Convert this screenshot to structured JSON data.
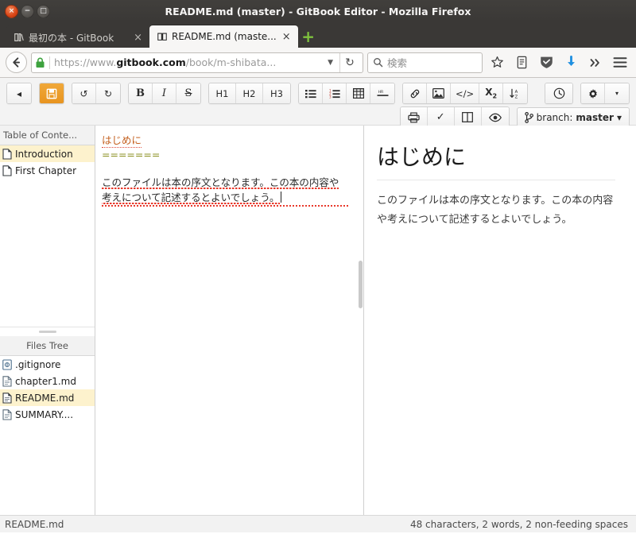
{
  "window": {
    "title": "README.md (master) - GitBook Editor - Mozilla Firefox",
    "close_label": "×",
    "minimize_label": "−",
    "maximize_label": "□"
  },
  "browser": {
    "tabs": [
      {
        "label": "最初の本 - GitBook",
        "close": "×",
        "icon": "gitbook-icon",
        "active": false
      },
      {
        "label": "README.md (maste...",
        "close": "×",
        "icon": "gitbook-icon",
        "active": true
      }
    ],
    "new_tab_label": "+",
    "back_label": "←",
    "url_prefix": "https://www.",
    "url_domain": "gitbook.com",
    "url_path": "/book/m-shibata...",
    "url_dropdown": "▼",
    "reload_label": "↻",
    "search_placeholder": "検索",
    "nav_icons": [
      "bookmark-star-icon",
      "reader-list-icon",
      "shield-icon",
      "downloads-icon",
      "overflow-chevrons-icon",
      "hamburger-menu-icon"
    ]
  },
  "editor_toolbar": {
    "row1": [
      {
        "group": [
          {
            "name": "back-button",
            "glyph": "◂"
          }
        ]
      },
      {
        "group": [
          {
            "name": "save-button",
            "glyph": "save-icon",
            "active": true
          }
        ]
      },
      {
        "group": [
          {
            "name": "undo-button",
            "glyph": "↺"
          },
          {
            "name": "redo-button",
            "glyph": "↻"
          }
        ]
      },
      {
        "group": [
          {
            "name": "bold-button",
            "glyph": "B"
          },
          {
            "name": "italic-button",
            "glyph": "I"
          },
          {
            "name": "strikethrough-button",
            "glyph": "S"
          }
        ]
      },
      {
        "group": [
          {
            "name": "heading1-button",
            "glyph": "H1"
          },
          {
            "name": "heading2-button",
            "glyph": "H2"
          },
          {
            "name": "heading3-button",
            "glyph": "H3"
          }
        ]
      },
      {
        "group": [
          {
            "name": "bullet-list-button",
            "glyph": "list-ul-icon"
          },
          {
            "name": "numbered-list-button",
            "glyph": "list-ol-icon"
          },
          {
            "name": "table-button",
            "glyph": "table-icon"
          },
          {
            "name": "horizontal-rule-button",
            "glyph": "HR"
          }
        ]
      },
      {
        "group": [
          {
            "name": "link-button",
            "glyph": "link-icon"
          },
          {
            "name": "image-button",
            "glyph": "image-icon"
          },
          {
            "name": "code-button",
            "glyph": "</>"
          },
          {
            "name": "subscript-button",
            "glyph": "X2"
          },
          {
            "name": "sort-button",
            "glyph": "sort-az-icon"
          }
        ]
      },
      {
        "group": [
          {
            "name": "history-button",
            "glyph": "clock-icon"
          }
        ]
      },
      {
        "group": [
          {
            "name": "settings-button",
            "glyph": "gear-icon"
          },
          {
            "name": "settings-dropdown-button",
            "glyph": "▾"
          }
        ]
      }
    ],
    "row2": [
      {
        "group": [
          {
            "name": "print-button",
            "glyph": "printer-icon"
          },
          {
            "name": "spellcheck-button",
            "glyph": "✓"
          },
          {
            "name": "split-view-button",
            "glyph": "columns-icon"
          },
          {
            "name": "preview-button",
            "glyph": "eye-icon"
          }
        ]
      }
    ],
    "branch": {
      "icon": "branch-icon",
      "prefix": "branch:",
      "name": "master",
      "caret": "▾"
    }
  },
  "sidebar": {
    "toc": {
      "header": "Table of Conte...",
      "items": [
        {
          "label": "Introduction",
          "icon": "file-icon",
          "selected": true
        },
        {
          "label": "First Chapter",
          "icon": "file-icon",
          "selected": false
        }
      ]
    },
    "files": {
      "header": "Files Tree",
      "items": [
        {
          "label": ".gitignore",
          "icon": "git-file-icon",
          "selected": false
        },
        {
          "label": "chapter1.md",
          "icon": "file-icon",
          "selected": false
        },
        {
          "label": "README.md",
          "icon": "file-icon",
          "selected": true
        },
        {
          "label": "SUMMARY....",
          "icon": "file-icon",
          "selected": false
        }
      ]
    }
  },
  "editor": {
    "heading": "はじめに",
    "underline": "=======",
    "paragraph": "このファイルは本の序文となります。この本の内容や考えについて記述するとよいでしょう。"
  },
  "preview": {
    "heading": "はじめに",
    "paragraph": "このファイルは本の序文となります。この本の内容や考えについて記述するとよいでしょう。"
  },
  "statusbar": {
    "filename": "README.md",
    "counts": "48 characters, 2 words, 2 non-feeding spaces"
  },
  "colors": {
    "accent": "#e8941f",
    "selection": "#fdf2cd",
    "titlebar": "#3a3836",
    "spellcheck": "#e8392b",
    "heading_md": "#c4601f",
    "equals_md": "#8a8f1f"
  }
}
